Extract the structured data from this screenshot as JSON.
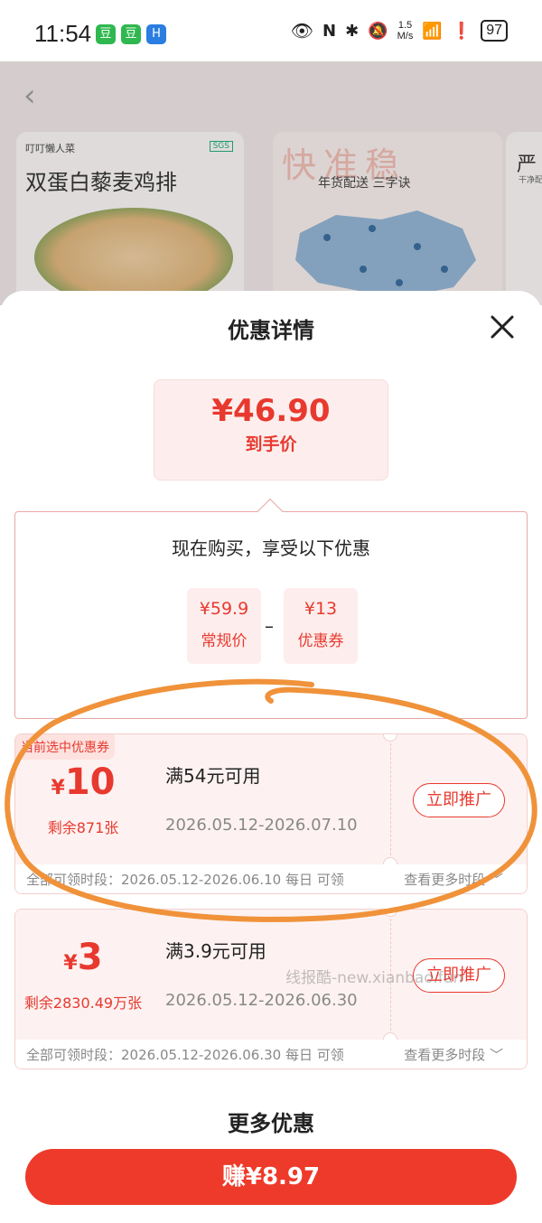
{
  "status_bar": {
    "time": "11:54",
    "app_icons": [
      "豆",
      "豆",
      "H"
    ],
    "net_speed_value": "1.5",
    "net_speed_unit": "M/s",
    "battery": "97"
  },
  "background_page": {
    "card1_brand": "叮叮懒人菜",
    "card1_badge": "SGS",
    "card1_title": "双蛋白藜麦鸡排",
    "card2_headline": "快准稳",
    "card2_subtitle": "年货配送 三字诀",
    "card3_title": "严",
    "card3_sub": "干净配"
  },
  "sheet": {
    "title": "优惠详情",
    "final_price": "¥46.90",
    "final_price_label": "到手价",
    "breakdown_title": "现在购买，享受以下优惠",
    "regular_price": "¥59.9",
    "regular_price_label": "常规价",
    "minus_sign": "–",
    "coupon_discount": "¥13",
    "coupon_discount_label": "优惠券"
  },
  "coupons": [
    {
      "selected_tag": "当前选中优惠券",
      "currency": "¥",
      "amount": "10",
      "remaining": "剩余871张",
      "condition": "满54元可用",
      "valid_period": "2026.05.12-2026.07.10",
      "action_label": "立即推广",
      "claim_period": "全部可领时段：2026.05.12-2026.06.10 每日 可领",
      "more_periods": "查看更多时段 ﹀"
    },
    {
      "currency": "¥",
      "amount": "3",
      "remaining": "剩余2830.49万张",
      "condition": "满3.9元可用",
      "valid_period": "2026.05.12-2026.06.30",
      "action_label": "立即推广",
      "claim_period": "全部可领时段：2026.05.12-2026.06.30 每日 可领",
      "more_periods": "查看更多时段 ﹀"
    }
  ],
  "watermark": "线报酷-new.xianbao.fun",
  "more_section_title": "更多优惠",
  "earn_button_label": "赚¥8.97",
  "colors": {
    "accent": "#e8392f",
    "button": "#ee3a2a",
    "coupon_bg": "#fdf2f1",
    "annotation": "#f0923a"
  }
}
